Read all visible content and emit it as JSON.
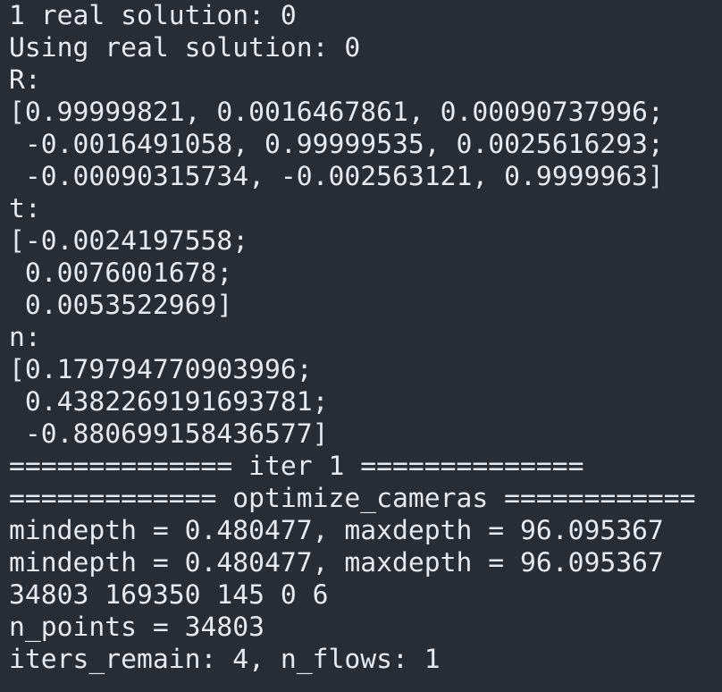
{
  "terminal": {
    "lines": [
      "1 real solution: 0",
      "Using real solution: 0",
      "R:",
      "[0.99999821, 0.0016467861, 0.00090737996;",
      " -0.0016491058, 0.99999535, 0.0025616293;",
      " -0.00090315734, -0.002563121, 0.9999963]",
      "t:",
      "[-0.0024197558;",
      " 0.0076001678;",
      " 0.0053522969]",
      "n:",
      "[0.179794770903996;",
      " 0.4382269191693781;",
      " -0.880699158436577]",
      "============== iter 1 ==============",
      "============= optimize_cameras ============",
      "mindepth = 0.480477, maxdepth = 96.095367",
      "mindepth = 0.480477, maxdepth = 96.095367",
      "34803 169350 145 0 6",
      "n_points = 34803",
      "iters_remain: 4, n_flows: 1"
    ]
  },
  "colors": {
    "background": "#282c34",
    "foreground": "#e6e9ef"
  }
}
